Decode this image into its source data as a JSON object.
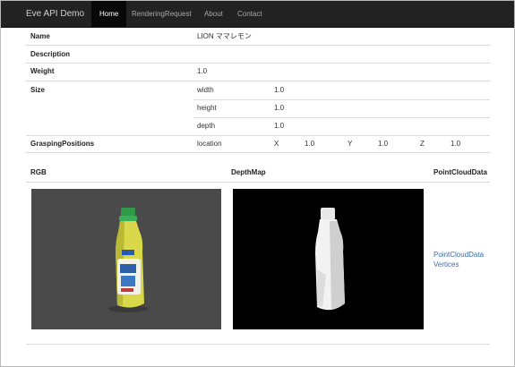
{
  "navbar": {
    "brand": "Eve API Demo",
    "items": [
      "Home",
      "RenderingRequest",
      "About",
      "Contact"
    ],
    "active_index": 0
  },
  "details": {
    "name_label": "Name",
    "name_value": "LION ママレモン",
    "description_label": "Description",
    "weight_label": "Weight",
    "weight_value": "1.0",
    "size_label": "Size",
    "size": [
      {
        "label": "width",
        "value": "1.0"
      },
      {
        "label": "height",
        "value": "1.0"
      },
      {
        "label": "depth",
        "value": "1.0"
      }
    ],
    "grasping_label": "GraspingPositions",
    "grasping": {
      "label": "location",
      "x_label": "X",
      "x_value": "1.0",
      "y_label": "Y",
      "y_value": "1.0",
      "z_label": "Z",
      "z_value": "1.0"
    }
  },
  "images": {
    "rgb_label": "RGB",
    "depth_label": "DepthMap",
    "pointcloud_label": "PointCloudData",
    "pointcloud_links": [
      "PointCloudData",
      "Vertices"
    ]
  },
  "colors": {
    "navbar_bg": "#222222",
    "nav_active_bg": "#080808",
    "link": "#3a6ea8",
    "rgb_bg": "#4a4a4a",
    "depth_bg": "#000000",
    "bottle_body": "#d8d84a",
    "bottle_cap": "#2f9a4a"
  }
}
